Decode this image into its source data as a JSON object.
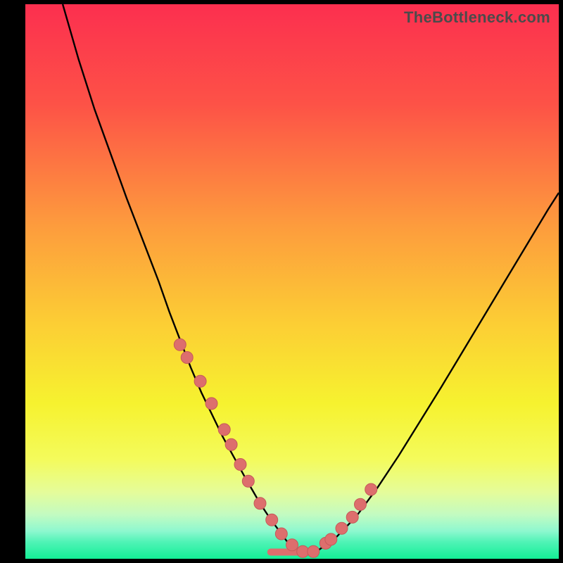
{
  "watermark": "TheBottleneck.com",
  "colors": {
    "frame": "#000000",
    "curve": "#000000",
    "dot_fill": "#dd6e6d",
    "dot_stroke": "#c55a59",
    "watermark": "#4b4b4b",
    "gradient_stops": [
      {
        "offset": "0%",
        "color": "#fc2f4f"
      },
      {
        "offset": "18%",
        "color": "#fd5247"
      },
      {
        "offset": "40%",
        "color": "#fd9c3d"
      },
      {
        "offset": "58%",
        "color": "#fccf34"
      },
      {
        "offset": "72%",
        "color": "#f6f22f"
      },
      {
        "offset": "82%",
        "color": "#f4fb5b"
      },
      {
        "offset": "88%",
        "color": "#e5fc9a"
      },
      {
        "offset": "92%",
        "color": "#c3fbc1"
      },
      {
        "offset": "95%",
        "color": "#8ef8cf"
      },
      {
        "offset": "97%",
        "color": "#4ff3b6"
      },
      {
        "offset": "100%",
        "color": "#13ef96"
      }
    ]
  },
  "chart_data": {
    "type": "line",
    "title": "",
    "xlabel": "",
    "ylabel": "",
    "xlim": [
      0,
      100
    ],
    "ylim": [
      0,
      100
    ],
    "series": [
      {
        "name": "curve",
        "x": [
          7,
          10,
          13,
          16,
          19,
          22,
          25,
          27,
          29,
          31,
          33,
          35,
          37,
          39,
          41,
          42.5,
          44,
          45.5,
          47,
          49,
          51,
          53,
          55,
          58,
          62,
          66,
          70,
          74,
          78,
          82,
          86,
          90,
          94,
          98,
          100
        ],
        "y": [
          100,
          90,
          81,
          73,
          65,
          57.5,
          50,
          44.5,
          39.5,
          34.5,
          30,
          26,
          22,
          18.5,
          15,
          12.5,
          10,
          7.8,
          5.8,
          3.2,
          1.6,
          1.0,
          1.6,
          3.6,
          7.6,
          12.8,
          18.6,
          24.8,
          31,
          37.4,
          43.8,
          50.2,
          56.6,
          63,
          66
        ]
      }
    ],
    "markers": {
      "name": "dots",
      "x": [
        29.0,
        30.3,
        32.8,
        34.9,
        37.3,
        38.6,
        40.3,
        41.8,
        44.0,
        46.2,
        48.0,
        50.0,
        52.0,
        54.0,
        56.3,
        57.3,
        59.3,
        61.3,
        62.8,
        64.8
      ],
      "y": [
        38.6,
        36.3,
        32.0,
        28.0,
        23.3,
        20.6,
        17.0,
        14.0,
        10.0,
        7.0,
        4.5,
        2.5,
        1.3,
        1.3,
        2.8,
        3.5,
        5.5,
        7.5,
        9.8,
        12.5
      ]
    },
    "flat_segment": {
      "x0": 46,
      "x1": 54,
      "y": 1.2
    }
  }
}
